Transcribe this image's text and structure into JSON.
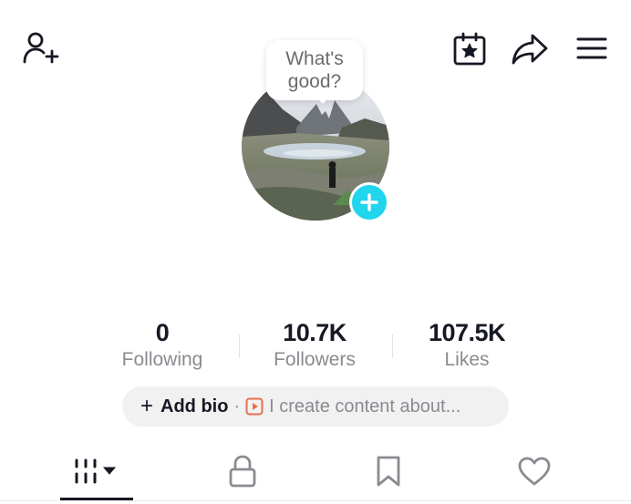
{
  "header": {
    "icons": {
      "add_friend": "person-plus-icon",
      "calendar": "calendar-star-icon",
      "share": "share-arrow-icon",
      "menu": "hamburger-menu-icon"
    }
  },
  "profile": {
    "bubble_line1": "What's",
    "bubble_line2": "good?",
    "add_avatar_icon": "plus-icon",
    "accent_color": "#20d5ec"
  },
  "stats": [
    {
      "value": "0",
      "label": "Following"
    },
    {
      "value": "10.7K",
      "label": "Followers"
    },
    {
      "value": "107.5K",
      "label": "Likes"
    }
  ],
  "bio": {
    "plus": "+",
    "add_label": "Add bio",
    "separator": "·",
    "hint": "I create content about...",
    "hint_icon": "video-play-icon",
    "hint_icon_color": "#e5704b"
  },
  "tabs": [
    {
      "name": "videos-grid",
      "icon": "grid-dropdown-icon",
      "active": true
    },
    {
      "name": "private",
      "icon": "lock-icon",
      "active": false
    },
    {
      "name": "saved",
      "icon": "bookmark-icon",
      "active": false
    },
    {
      "name": "liked",
      "icon": "heart-icon",
      "active": false
    }
  ]
}
